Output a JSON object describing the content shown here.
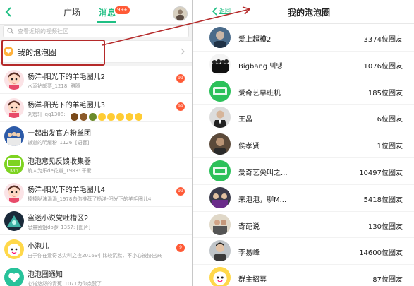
{
  "left": {
    "header": {
      "tab_square": "广场",
      "tab_messages": "消息",
      "messages_badge": "99+"
    },
    "search": {
      "placeholder": "查看近期的视频社区"
    },
    "bubble_entry": {
      "label": "我的泡泡圈"
    },
    "chats": [
      {
        "title": "杨洋-阳光下的羊毛圈儿2",
        "preview": "水添钻邮票_1218: 雅腾",
        "badge": "99",
        "avatar": "girl-cartoon"
      },
      {
        "title": "杨洋-阳光下的羊毛圈儿3",
        "preview": "刘宏轩_qq1308:",
        "badge": "99",
        "avatar": "girl-cartoon",
        "has_emojis": true
      },
      {
        "title": "一起出发官方粉丝团",
        "preview": "谦逊的明耀粉_1126: [语音]",
        "badge": "",
        "avatar": "team-photo"
      },
      {
        "title": "泡泡意见反馈收集器",
        "preview": "航人为乐de花瓣_1983: 干爱",
        "badge": "",
        "avatar": "iqiyi-logo"
      },
      {
        "title": "杨洋-阳光下的羊毛圈儿4",
        "preview": "捧捧哒沫涓涓_1978向你推荐了杨洋-阳光下的羊毛圈儿4",
        "badge": "99",
        "avatar": "girl-cartoon"
      },
      {
        "title": "盗迷小说党吐槽区2",
        "preview": "思量罢蛆do爹_1357: [图片]",
        "badge": "",
        "avatar": "dark-game"
      },
      {
        "title": "小泡儿",
        "preview": "由于你在爱奇艺尖叫之夜2016S中比较沉默，不小心被挤出来",
        "badge": "9",
        "avatar": "bubble-mascot"
      },
      {
        "title": "泡泡圈通知",
        "preview": "心诺悠然的青蕉_1071为你点赞了",
        "badge": "",
        "avatar": "heart-circle"
      }
    ]
  },
  "right": {
    "header": {
      "back_label": "返回",
      "title": "我的泡泡圈"
    },
    "circles": [
      {
        "name": "爱上超模2",
        "count": "3374位圈友",
        "avatar": "portrait-blue"
      },
      {
        "name": "Bigbang 빅뱅",
        "count": "1076位圈友",
        "avatar": "band"
      },
      {
        "name": "爱奇艺早班机",
        "count": "185位圈友",
        "avatar": "green-logo"
      },
      {
        "name": "王晶",
        "count": "6位圈友",
        "avatar": "man-suit"
      },
      {
        "name": "侯孝贤",
        "count": "1位圈友",
        "avatar": "portrait-dark"
      },
      {
        "name": "爱奇艺尖叫之...",
        "count": "10497位圈友",
        "avatar": "green-logo"
      },
      {
        "name": "来泡泡，聊M...",
        "count": "5418位圈友",
        "avatar": "group-photo"
      },
      {
        "name": "奇葩说",
        "count": "130位圈友",
        "avatar": "show-photo"
      },
      {
        "name": "李易峰",
        "count": "14600位圈友",
        "avatar": "portrait-man"
      },
      {
        "name": "群主招募",
        "count": "87位圈友",
        "avatar": "bubble-mascot"
      }
    ]
  },
  "colors": {
    "accent": "#1fbf83",
    "badge": "#ff5a36",
    "annotation": "#b52a2a",
    "bubble_icon": "#ffb13c"
  }
}
